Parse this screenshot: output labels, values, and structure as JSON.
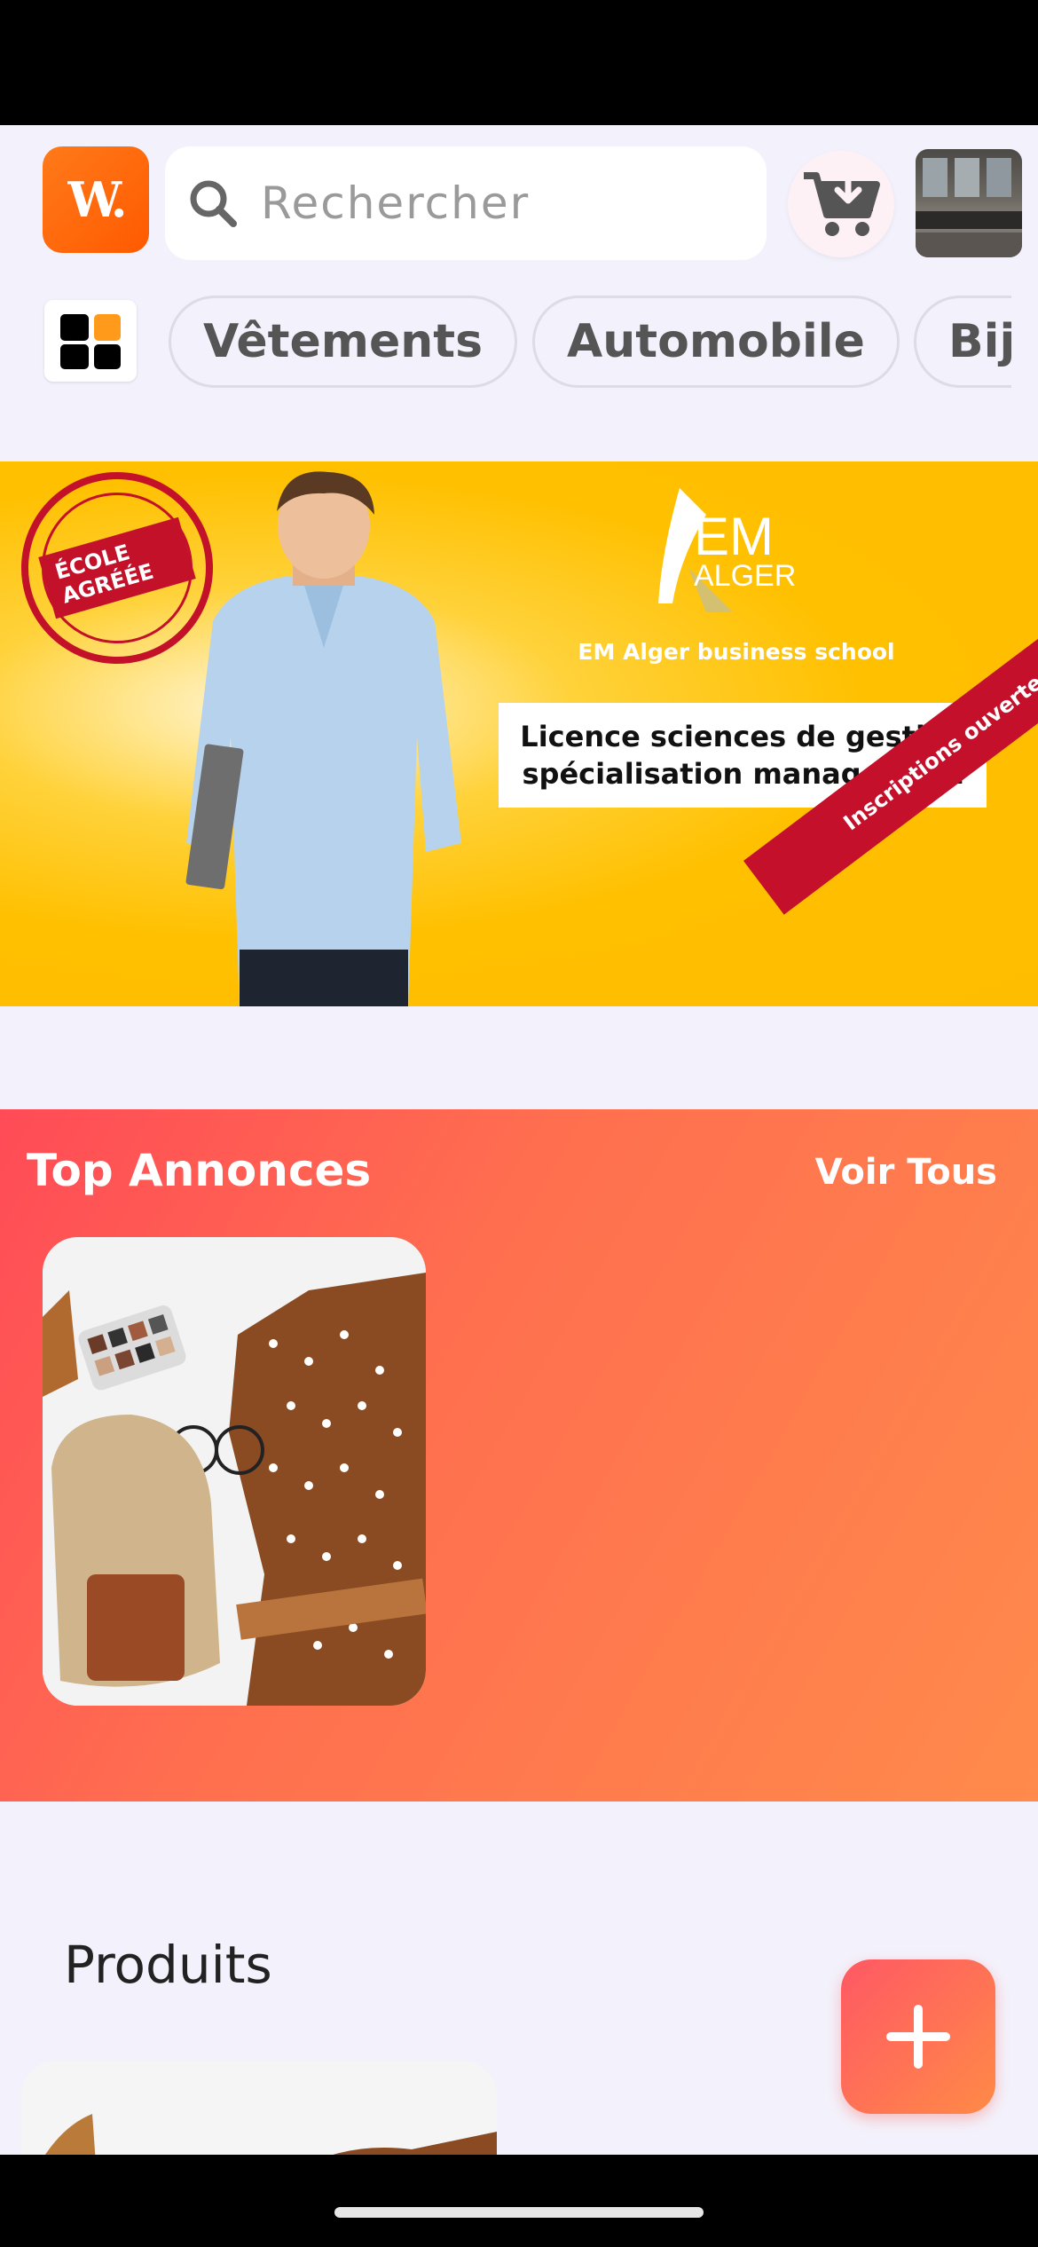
{
  "header": {
    "logo_text": "W.",
    "search_placeholder": "Rechercher"
  },
  "categories": [
    "Vêtements",
    "Automobile",
    "Bijoux"
  ],
  "banner": {
    "seal_text": "ÉCOLE AGRÉÉE",
    "brand_em": "EM",
    "brand_alger": "ALGER",
    "school": "EM Alger business school",
    "licence_line1": "Licence sciences de gestion",
    "licence_line2": "spécialisation management",
    "ribbon": "Inscriptions ouvertes"
  },
  "top_annonces": {
    "title": "Top Annonces",
    "see_all": "Voir Tous"
  },
  "produits": {
    "title": "Produits"
  },
  "icons": {
    "search": "search-icon",
    "cart": "cart-download-icon",
    "grid": "grid-icon",
    "add": "plus-icon"
  },
  "colors": {
    "accent": "#ff5a00",
    "gradient_start": "#ff4b57",
    "gradient_end": "#ff8a4b",
    "banner_yellow": "#ffc000"
  }
}
